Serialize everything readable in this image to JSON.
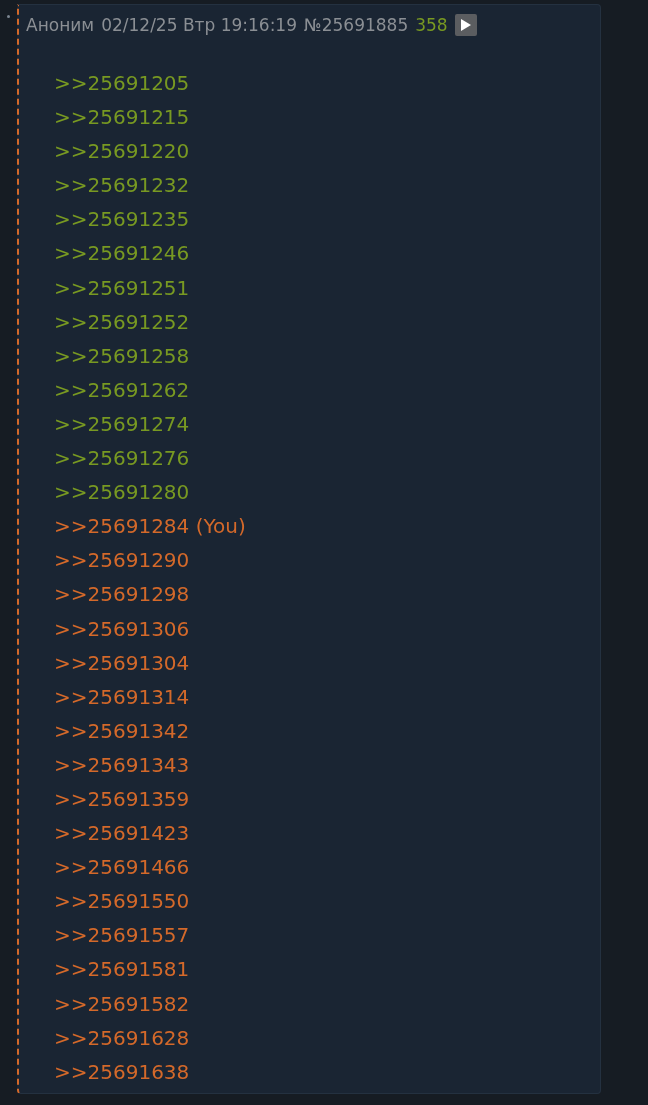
{
  "post": {
    "name": "Аноним",
    "date": "02/12/25 Втр 19:16:19",
    "number": "№25691885",
    "ordinal": "358",
    "replies": [
      {
        "text": ">>25691205",
        "color": "#789922"
      },
      {
        "text": ">>25691215",
        "color": "#789922"
      },
      {
        "text": ">>25691220",
        "color": "#789922"
      },
      {
        "text": ">>25691232",
        "color": "#789922"
      },
      {
        "text": ">>25691235",
        "color": "#789922"
      },
      {
        "text": ">>25691246",
        "color": "#789922"
      },
      {
        "text": ">>25691251",
        "color": "#789922"
      },
      {
        "text": ">>25691252",
        "color": "#789922"
      },
      {
        "text": ">>25691258",
        "color": "#789922"
      },
      {
        "text": ">>25691262",
        "color": "#789922"
      },
      {
        "text": ">>25691274",
        "color": "#789922"
      },
      {
        "text": ">>25691276",
        "color": "#789922"
      },
      {
        "text": ">>25691280",
        "color": "#789922"
      },
      {
        "text": ">>25691284 (You)",
        "color": "#d4692a"
      },
      {
        "text": ">>25691290",
        "color": "#d4692a"
      },
      {
        "text": ">>25691298",
        "color": "#d4692a"
      },
      {
        "text": ">>25691306",
        "color": "#d4692a"
      },
      {
        "text": ">>25691304",
        "color": "#d4692a"
      },
      {
        "text": ">>25691314",
        "color": "#d4692a"
      },
      {
        "text": ">>25691342",
        "color": "#d4692a"
      },
      {
        "text": ">>25691343",
        "color": "#d4692a"
      },
      {
        "text": ">>25691359",
        "color": "#d4692a"
      },
      {
        "text": ">>25691423",
        "color": "#d4692a"
      },
      {
        "text": ">>25691466",
        "color": "#d4692a"
      },
      {
        "text": ">>25691550",
        "color": "#d4692a"
      },
      {
        "text": ">>25691557",
        "color": "#d4692a"
      },
      {
        "text": ">>25691581",
        "color": "#d4692a"
      },
      {
        "text": ">>25691582",
        "color": "#d4692a"
      },
      {
        "text": ">>25691628",
        "color": "#d4692a"
      },
      {
        "text": ">>25691638",
        "color": "#d4692a"
      }
    ]
  }
}
